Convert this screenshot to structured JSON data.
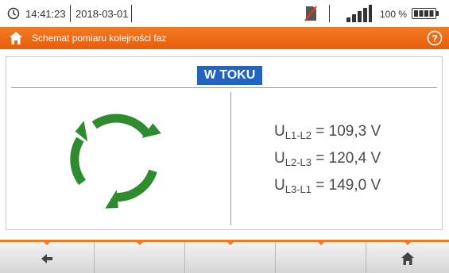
{
  "status_bar": {
    "time": "14:41:23",
    "date": "2018-03-01",
    "battery_percent": "100 %",
    "icons": [
      "clock-icon",
      "no-sim-icon",
      "signal-bars-icon",
      "battery-icon"
    ]
  },
  "header": {
    "title": "Schemat pomiaru kolejności faz",
    "icons": [
      "home-icon",
      "help-icon"
    ],
    "accent_color": "#f47a20"
  },
  "main": {
    "status_badge": "W TOKU",
    "status_color": "#2264c4",
    "rotation_icon": "phase-rotation-clockwise-icon",
    "rotation_color": "#2e8b2e",
    "measurements": [
      {
        "prefix": "U",
        "sub": "L1-L2",
        "value": " = 109,3 V"
      },
      {
        "prefix": "U",
        "sub": "L2-L3",
        "value": " = 120,4 V"
      },
      {
        "prefix": "U",
        "sub": "L3-L1",
        "value": " = 149,0 V"
      }
    ]
  },
  "bottom_bar": {
    "buttons": [
      {
        "icon": "back-arrow-icon"
      },
      {
        "icon": ""
      },
      {
        "icon": ""
      },
      {
        "icon": ""
      },
      {
        "icon": "home-icon"
      }
    ]
  }
}
